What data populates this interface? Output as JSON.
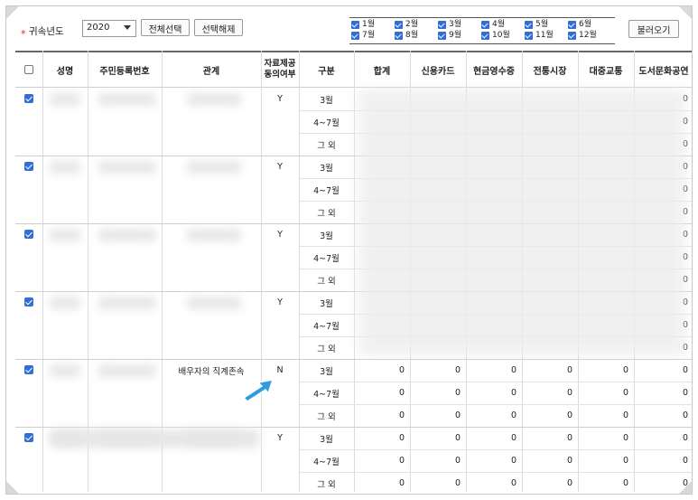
{
  "toolbar": {
    "required_mark": "*",
    "year_label": "귀속년도",
    "year_value": "2020",
    "select_all_label": "전체선택",
    "deselect_label": "선택해제",
    "load_label": "불러오기",
    "months": [
      {
        "label": "1월",
        "checked": true
      },
      {
        "label": "2월",
        "checked": true
      },
      {
        "label": "3월",
        "checked": true
      },
      {
        "label": "4월",
        "checked": true
      },
      {
        "label": "5월",
        "checked": true
      },
      {
        "label": "6월",
        "checked": true
      },
      {
        "label": "7월",
        "checked": true
      },
      {
        "label": "8월",
        "checked": true
      },
      {
        "label": "9월",
        "checked": true
      },
      {
        "label": "10월",
        "checked": true
      },
      {
        "label": "11월",
        "checked": true
      },
      {
        "label": "12월",
        "checked": true
      }
    ]
  },
  "table": {
    "headers": {
      "name": "성명",
      "rrn": "주민등록번호",
      "relation": "관계",
      "consent_line1": "자료제공",
      "consent_line2": "동의여부",
      "category": "구분",
      "total": "합계",
      "credit_card": "신용카드",
      "cash_receipt": "현금영수증",
      "traditional_market": "전통시장",
      "public_transport": "대중교통",
      "culture": "도서문화공연"
    },
    "periods": [
      "3월",
      "4~7월",
      "그 외"
    ],
    "groups": [
      {
        "checked": true,
        "relation": "",
        "consent": "Y",
        "values": [
          [
            "",
            "",
            "",
            "",
            "",
            "0"
          ],
          [
            "",
            "",
            "",
            "",
            "",
            "0"
          ],
          [
            "",
            "",
            "",
            "",
            "",
            "0"
          ]
        ]
      },
      {
        "checked": true,
        "relation": "",
        "consent": "Y",
        "values": [
          [
            "",
            "",
            "",
            "",
            "",
            "0"
          ],
          [
            "",
            "",
            "",
            "",
            "",
            "0"
          ],
          [
            "",
            "",
            "",
            "",
            "",
            "0"
          ]
        ]
      },
      {
        "checked": true,
        "relation": "",
        "consent": "Y",
        "values": [
          [
            "",
            "",
            "",
            "",
            "",
            "0"
          ],
          [
            "",
            "",
            "",
            "",
            "",
            "0"
          ],
          [
            "",
            "",
            "",
            "",
            "",
            "0"
          ]
        ]
      },
      {
        "checked": true,
        "relation": "",
        "consent": "Y",
        "values": [
          [
            "",
            "",
            "",
            "",
            "",
            "0"
          ],
          [
            "",
            "",
            "",
            "",
            "",
            "0"
          ],
          [
            "",
            "",
            "",
            "",
            "",
            "0"
          ]
        ]
      },
      {
        "checked": true,
        "relation": "배우자의 직계존속",
        "consent": "N",
        "values": [
          [
            "0",
            "0",
            "0",
            "0",
            "0",
            "0"
          ],
          [
            "0",
            "0",
            "0",
            "0",
            "0",
            "0"
          ],
          [
            "0",
            "0",
            "0",
            "0",
            "0",
            "0"
          ]
        ]
      },
      {
        "checked": true,
        "relation": "",
        "consent": "Y",
        "values": [
          [
            "0",
            "0",
            "0",
            "0",
            "0",
            "0"
          ],
          [
            "0",
            "0",
            "0",
            "0",
            "0",
            "0"
          ],
          [
            "0",
            "0",
            "0",
            "0",
            "0",
            "0"
          ]
        ]
      }
    ]
  },
  "colors": {
    "accent": "#2f6fd6",
    "pointer": "#2f9be0",
    "required": "#dd2222"
  }
}
